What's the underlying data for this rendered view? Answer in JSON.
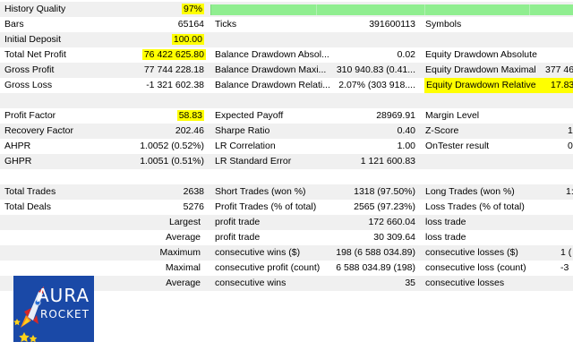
{
  "colors": {
    "highlight": "#ffff00",
    "quality_bar": "#90ee90",
    "stripe": "#f0f0f0",
    "logo_bg": "#1a49a7"
  },
  "history_quality": {
    "label": "History Quality",
    "value": "97%",
    "fraction": 0.97
  },
  "rows": {
    "bars": {
      "l1": "Bars",
      "v1": "65164",
      "l2": "Ticks",
      "v2": "391600113",
      "l3": "Symbols",
      "v3": ""
    },
    "deposit": {
      "l1": "Initial Deposit",
      "v1": "100.00"
    },
    "net": {
      "l1": "Total Net Profit",
      "v1": "76 422 625.80",
      "l2": "Balance Drawdown Absol...",
      "v2": "0.02",
      "l3": "Equity Drawdown Absolute",
      "v3": ""
    },
    "gross_profit": {
      "l1": "Gross Profit",
      "v1": "77 744 228.18",
      "l2": "Balance Drawdown Maxi...",
      "v2": "310 940.83 (0.41...",
      "l3": "Equity Drawdown Maximal",
      "v3": "377 46"
    },
    "gross_loss": {
      "l1": "Gross Loss",
      "v1": "-1 321 602.38",
      "l2": "Balance Drawdown Relati...",
      "v2": "2.07% (303 918....",
      "l3": "Equity Drawdown Relative",
      "v3": "17.83%"
    },
    "profit_factor": {
      "l1": "Profit Factor",
      "v1": "58.83",
      "l2": "Expected Payoff",
      "v2": "28969.91",
      "l3": "Margin Level",
      "v3": ""
    },
    "recovery": {
      "l1": "Recovery Factor",
      "v1": "202.46",
      "l2": "Sharpe Ratio",
      "v2": "0.40",
      "l3": "Z-Score",
      "v3": "1"
    },
    "ahpr": {
      "l1": "AHPR",
      "v1": "1.0052 (0.52%)",
      "l2": "LR Correlation",
      "v2": "1.00",
      "l3": "OnTester result",
      "v3": "0"
    },
    "ghpr": {
      "l1": "GHPR",
      "v1": "1.0051 (0.51%)",
      "l2": "LR Standard Error",
      "v2": "1 121 600.83"
    },
    "trades": {
      "l1": "Total Trades",
      "v1": "2638",
      "l2": "Short Trades (won %)",
      "v2": "1318 (97.50%)",
      "l3": "Long Trades (won %)",
      "v3": "1:"
    },
    "deals": {
      "l1": "Total Deals",
      "v1": "5276",
      "l2": "Profit Trades (% of total)",
      "v2": "2565 (97.23%)",
      "l3": "Loss Trades (% of total)",
      "v3": ""
    },
    "largest": {
      "v1": "Largest",
      "l2": "profit trade",
      "v2": "172 660.04",
      "l3": "loss trade",
      "v3": ""
    },
    "average": {
      "v1": "Average",
      "l2": "profit trade",
      "v2": "30 309.64",
      "l3": "loss trade",
      "v3": ""
    },
    "maximum": {
      "v1": "Maximum",
      "l2": "consecutive wins ($)",
      "v2": "198 (6 588 034.89)",
      "l3": "consecutive losses ($)",
      "v3": "1 ("
    },
    "maximal": {
      "v1": "Maximal",
      "l2": "consecutive profit (count)",
      "v2": "6 588 034.89 (198)",
      "l3": "consecutive loss (count)",
      "v3": "-3"
    },
    "average2": {
      "v1": "Average",
      "l2": "consecutive wins",
      "v2": "35",
      "l3": "consecutive losses",
      "v3": ""
    }
  },
  "logo": {
    "line1": "AURA",
    "line2": "ROCKET"
  }
}
